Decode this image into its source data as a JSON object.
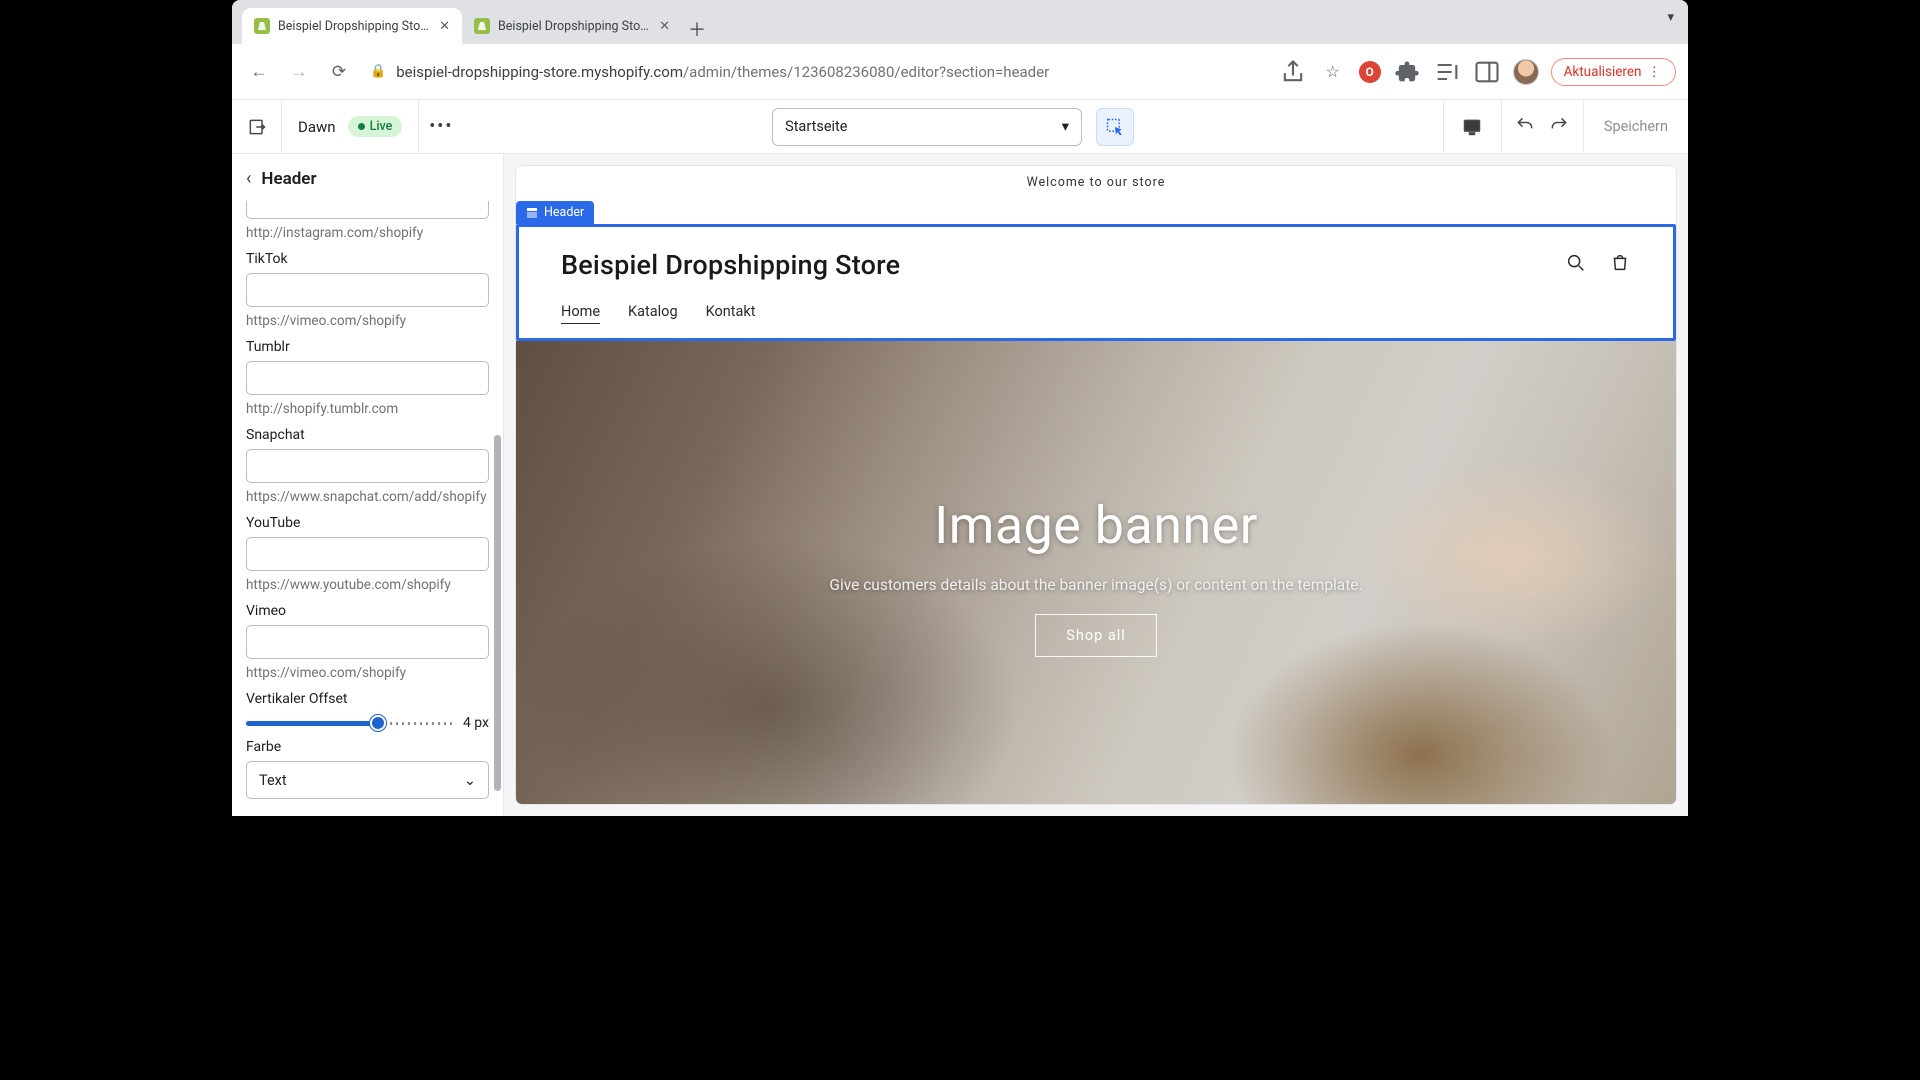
{
  "browser": {
    "tabs": [
      {
        "title": "Beispiel Dropshipping Store · D",
        "active": true
      },
      {
        "title": "Beispiel Dropshipping Store · E",
        "active": false
      }
    ],
    "url_host": "beispiel-dropshipping-store.myshopify.com",
    "url_path": "/admin/themes/123608236080/editor?section=header",
    "update_label": "Aktualisieren"
  },
  "topbar": {
    "theme_name": "Dawn",
    "live_label": "Live",
    "page_label": "Startseite",
    "save_label": "Speichern"
  },
  "panel": {
    "title": "Header",
    "fields": {
      "instagram_hint": "http://instagram.com/shopify",
      "tiktok": {
        "label": "TikTok",
        "hint": "https://vimeo.com/shopify"
      },
      "tumblr": {
        "label": "Tumblr",
        "hint": "http://shopify.tumblr.com"
      },
      "snapchat": {
        "label": "Snapchat",
        "hint": "https://www.snapchat.com/add/shopify"
      },
      "youtube": {
        "label": "YouTube",
        "hint": "https://www.youtube.com/shopify"
      },
      "vimeo": {
        "label": "Vimeo",
        "hint": "https://vimeo.com/shopify"
      },
      "offset": {
        "label": "Vertikaler Offset",
        "value_display": "4 px",
        "percent": 64
      },
      "farbe": {
        "label": "Farbe",
        "value": "Text"
      }
    }
  },
  "preview": {
    "announcement": "Welcome to our store",
    "selection_tag": "Header",
    "store_name": "Beispiel Dropshipping Store",
    "nav": {
      "home": "Home",
      "katalog": "Katalog",
      "kontakt": "Kontakt"
    },
    "hero": {
      "title": "Image banner",
      "subtitle": "Give customers details about the banner image(s) or content on the template.",
      "button": "Shop all"
    }
  }
}
